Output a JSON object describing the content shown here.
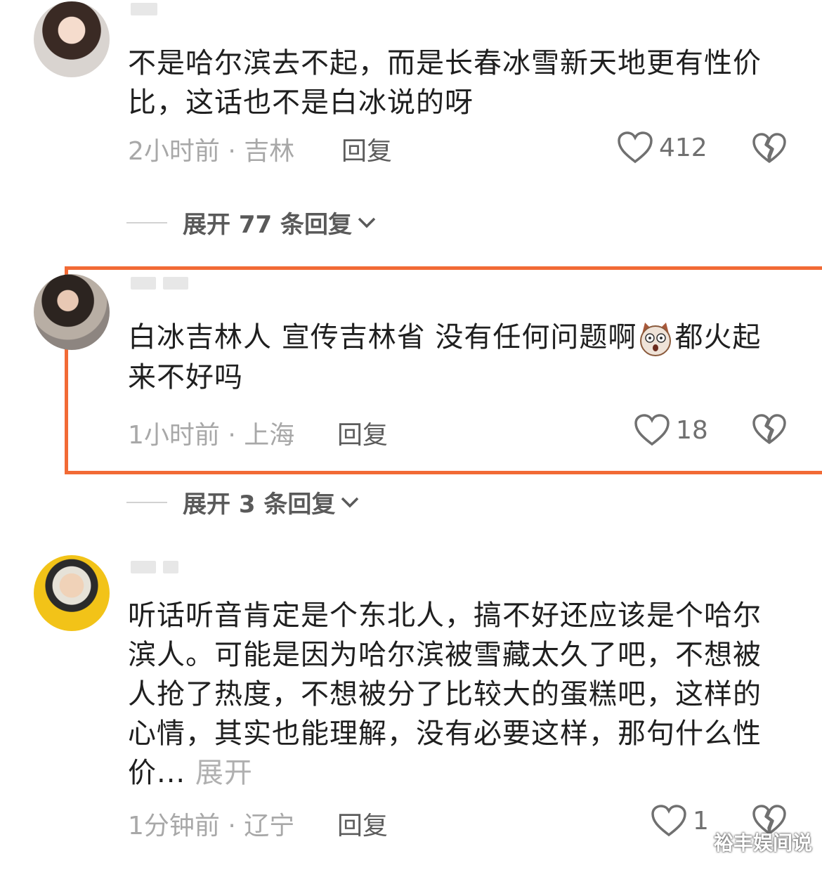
{
  "comments": [
    {
      "text": "不是哈尔滨去不起，而是长春冰雪新天地更有性价比，这话也不是白冰说的呀",
      "time": "2小时前 · 吉林",
      "reply_label": "回复",
      "likes": "412",
      "expand_label": "展开 77 条回复"
    },
    {
      "text_part1": "白冰吉林人 宣传吉林省 没有任何问题啊",
      "text_part2": "都火起来不好吗",
      "emoji": "dog-face-emoji",
      "time": "1小时前 · 上海",
      "reply_label": "回复",
      "likes": "18",
      "expand_label": "展开 3 条回复"
    },
    {
      "text": "听话听音肯定是个东北人，搞不好还应该是个哈尔滨人。可能是因为哈尔滨被雪藏太久了吧，不想被人抢了热度，不想被分了比较大的蛋糕吧，这样的心情，其实也能理解，没有必要这样，那句什么性价...",
      "more_label": "展开",
      "time": "1分钟前 · 辽宁",
      "reply_label": "回复",
      "likes": "1"
    }
  ],
  "highlight_color": "#f26a35",
  "watermark": "裕丰娱间说",
  "icons": [
    "heart-outline-icon",
    "broken-heart-icon",
    "chevron-down-icon"
  ]
}
